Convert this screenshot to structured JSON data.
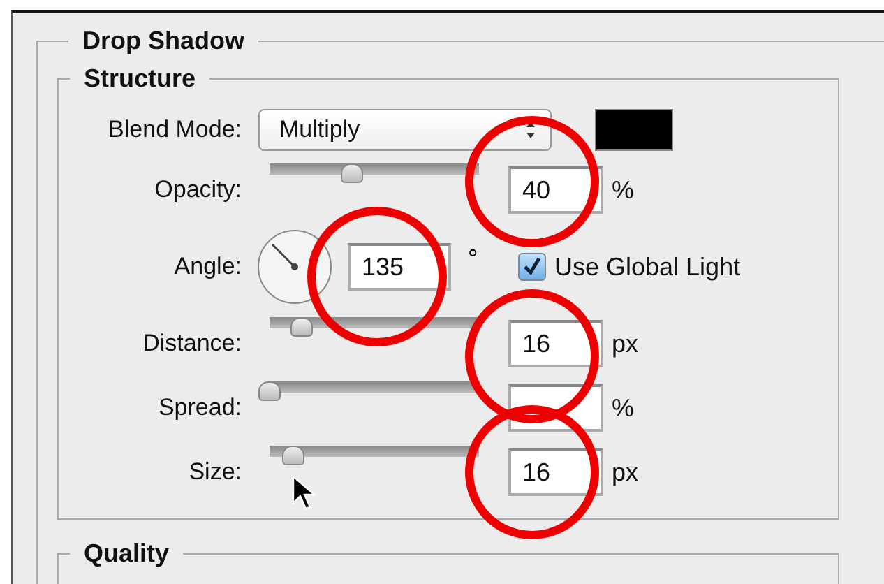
{
  "panel": {
    "title": "Drop Shadow",
    "structure": {
      "title": "Structure",
      "rows": [
        {
          "kind": "select",
          "label": "Blend Mode:",
          "value": "Multiply"
        },
        {
          "kind": "slider",
          "label": "Opacity:",
          "level": 0.39,
          "value": "40",
          "unit": "%"
        },
        {
          "kind": "angle",
          "label": "Angle:",
          "value": "135",
          "unit": "°",
          "checkbox": {
            "label": "Use Global Light",
            "checked": true
          }
        },
        {
          "kind": "slider",
          "label": "Distance:",
          "level": 0.15,
          "value": "16",
          "unit": "px"
        },
        {
          "kind": "slider",
          "label": "Spread:",
          "level": 0,
          "unit": "%"
        },
        {
          "kind": "slider",
          "label": "Size:",
          "level": 0.11,
          "value": "16",
          "unit": "px"
        }
      ]
    },
    "quality": {
      "title": "Quality"
    }
  }
}
